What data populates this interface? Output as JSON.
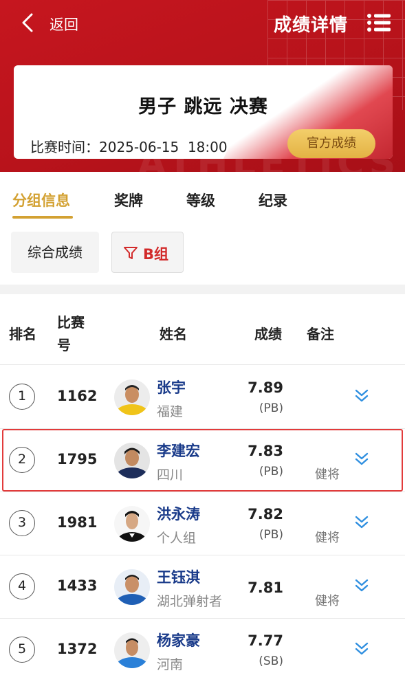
{
  "header": {
    "back_label": "返回",
    "title": "成绩详情"
  },
  "event": {
    "title": "男子 跳远 决赛",
    "time_label": "比赛时间：",
    "time_value": "2025-06-15  18:00",
    "official_label": "官方成绩"
  },
  "tabs": [
    {
      "label": "分组信息",
      "active": true
    },
    {
      "label": "奖牌",
      "active": false
    },
    {
      "label": "等级",
      "active": false
    },
    {
      "label": "纪录",
      "active": false
    }
  ],
  "filters": {
    "overall": "综合成绩",
    "group": "B组"
  },
  "table": {
    "headers": {
      "rank": "排名",
      "bib_line1": "比赛",
      "bib_line2": "号",
      "name": "姓名",
      "result": "成绩",
      "note": "备注"
    },
    "rows": [
      {
        "rank": "1",
        "bib": "1162",
        "name": "张宇",
        "team": "福建",
        "result": "7.89",
        "tag": "(PB)",
        "note": ""
      },
      {
        "rank": "2",
        "bib": "1795",
        "name": "李建宏",
        "team": "四川",
        "result": "7.83",
        "tag": "(PB)",
        "note": "健将"
      },
      {
        "rank": "3",
        "bib": "1981",
        "name": "洪永涛",
        "team": "个人组",
        "result": "7.82",
        "tag": "(PB)",
        "note": "健将"
      },
      {
        "rank": "4",
        "bib": "1433",
        "name": "王钰淇",
        "team": "湖北弹射者",
        "result": "7.81",
        "tag": "",
        "note": "健将"
      },
      {
        "rank": "5",
        "bib": "1372",
        "name": "杨家豪",
        "team": "河南",
        "result": "7.77",
        "tag": "(SB)",
        "note": ""
      }
    ]
  },
  "colors": {
    "header_red": "#c6161f",
    "gold": "#d3a132",
    "name_blue": "#1a3b8a",
    "highlight_red": "#e23b3b",
    "expand_blue": "#2f8fe0"
  },
  "icons": {
    "back": "back-chevron-icon",
    "menu": "menu-list-icon",
    "filter": "funnel-icon",
    "expand": "double-chevron-down-icon",
    "avatar": "athlete-avatar-icon"
  }
}
